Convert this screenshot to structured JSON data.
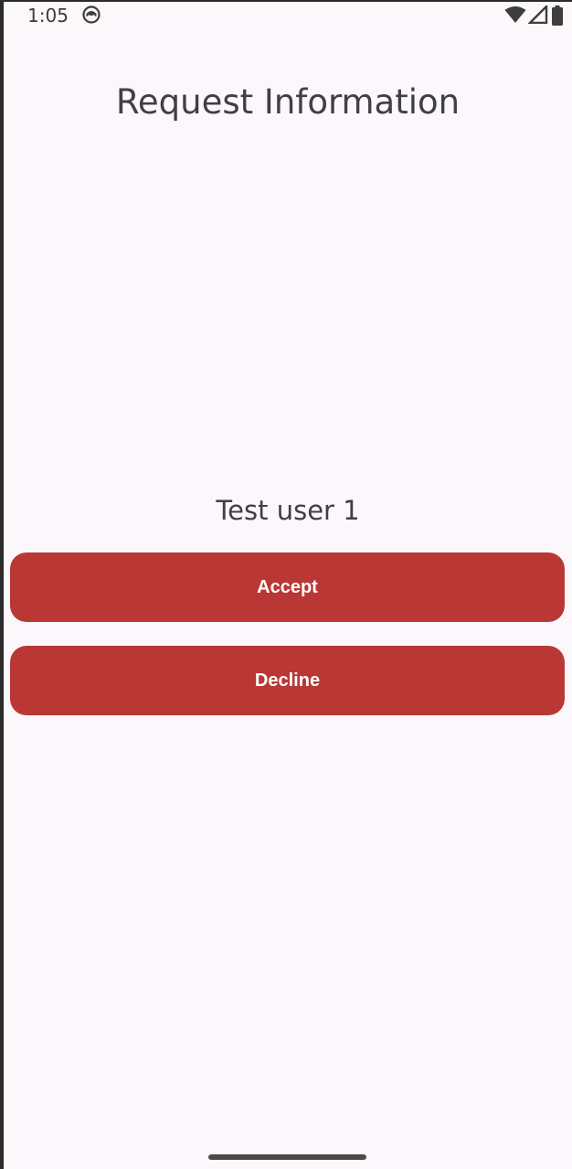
{
  "status_bar": {
    "time": "1:05",
    "app_icon": "ghost-app-icon",
    "indicators": [
      "wifi-icon",
      "signal-icon",
      "battery-icon"
    ]
  },
  "header": {
    "title": "Request Information"
  },
  "request": {
    "user_name": "Test user 1"
  },
  "actions": {
    "accept_label": "Accept",
    "decline_label": "Decline"
  },
  "colors": {
    "background": "#fcf7fb",
    "button": "#b93835",
    "button_text": "#ffffff",
    "text": "#3f3f45"
  }
}
